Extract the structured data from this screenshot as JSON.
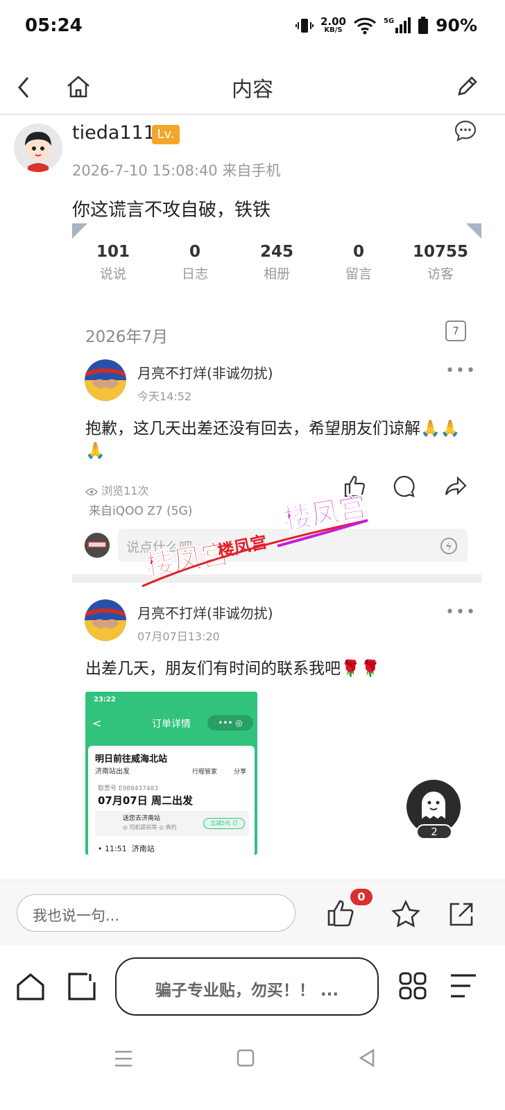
{
  "status_bar": {
    "time": "05:24",
    "speed_value": "2.00",
    "speed_unit": "KB/S",
    "network": "5G",
    "battery": "90%"
  },
  "topnav": {
    "title": "内容"
  },
  "post": {
    "username": "tieda111",
    "level_badge": "Lv.",
    "meta": "2026-7-10 15:08:40 来自手机",
    "text": "你这谎言不攻自破，铁铁"
  },
  "card": {
    "stats": [
      {
        "num": "101",
        "label": "说说"
      },
      {
        "num": "0",
        "label": "日志"
      },
      {
        "num": "245",
        "label": "相册"
      },
      {
        "num": "0",
        "label": "留言"
      },
      {
        "num": "10755",
        "label": "访客"
      }
    ],
    "month": "2026年7月",
    "calendar_day": "7",
    "feed1": {
      "name": "月亮不打烊(非诚勿扰)",
      "time": "今天14:52",
      "text": "抱歉，这几天出差还没有回去，希望朋友们谅解🙏🙏🙏",
      "views": "浏览11次",
      "device": "来自iQOO Z7 (5G)",
      "comment_placeholder": "说点什么吧"
    },
    "feed2": {
      "name": "月亮不打烊(非诚勿扰)",
      "time": "07月07日13:20",
      "text": "出差几天，朋友们有时间的联系我吧🌹🌹"
    },
    "ticket": {
      "status_time": "23:22",
      "header": "订单详情",
      "trip": "明日前往威海北站",
      "from": "济南站出发",
      "manager": "行程管家",
      "share": "分享",
      "ticket_no": "取票号 E988437483",
      "date": "07月07日 周二出发",
      "send": "送您去济南站",
      "driver": "◎ 司机提前等 ◎ 爽约",
      "discount": "立减5元",
      "order": "订",
      "dep_time": "11:51",
      "station": "济南站"
    }
  },
  "float_count": "2",
  "watermark": {
    "text": "楼凤宫"
  },
  "reply": {
    "placeholder": "我也说一句...",
    "like_count": "0"
  },
  "browser": {
    "title": "骗子专业贴，勿买！！ ..."
  }
}
